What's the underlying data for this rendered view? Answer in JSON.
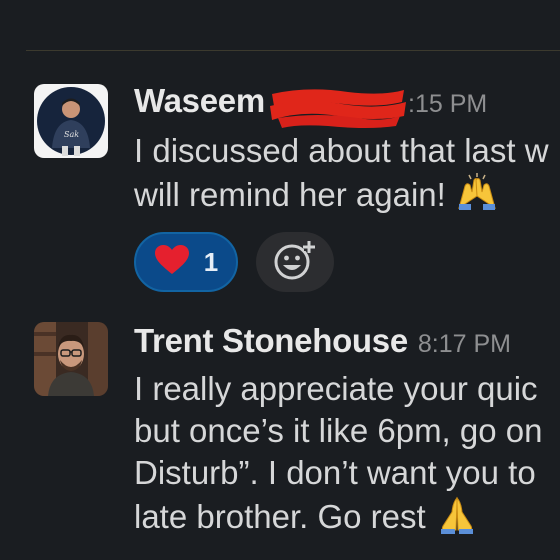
{
  "colors": {
    "background": "#1a1d21",
    "reaction_active": "#0b4a8a",
    "reaction_border": "#1264a3",
    "timestamp": "#8e8f91",
    "redaction": "#e0261a"
  },
  "messages": [
    {
      "author": "Waseem",
      "time": "8:15 PM",
      "time_visible": ":15 PM",
      "lines": [
        "I discussed about that last w",
        "will remind her again!"
      ],
      "end_emoji": "raising-hands-icon",
      "reactions": [
        {
          "emoji": "heart-icon",
          "count": "1"
        }
      ]
    },
    {
      "author": "Trent Stonehouse",
      "time": "8:17 PM",
      "lines": [
        "I really appreciate your quic",
        "but once’s it like 6pm, go on",
        "Disturb”. I don’t want you to",
        "late brother. Go rest"
      ],
      "end_emoji": "folded-hands-icon"
    }
  ]
}
